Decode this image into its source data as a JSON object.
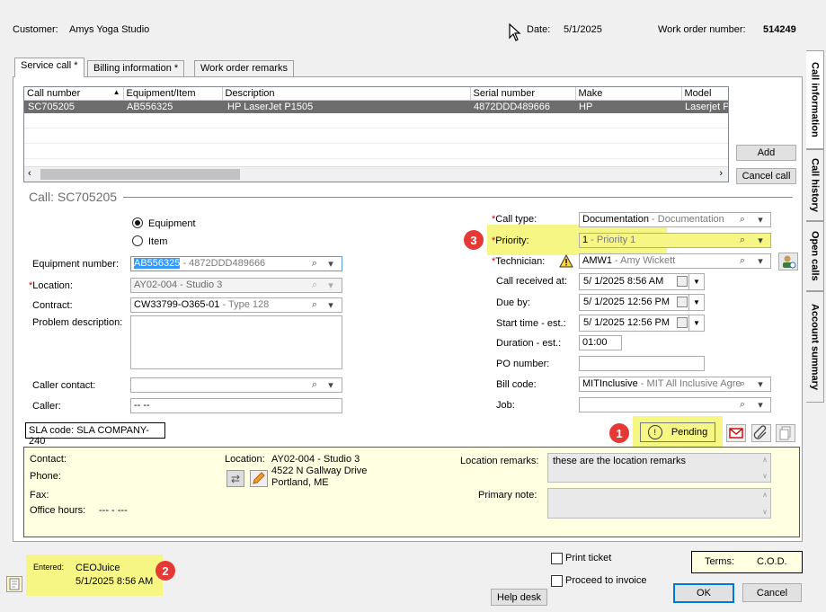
{
  "header": {
    "customer_label": "Customer:",
    "customer_value": "Amys Yoga Studio",
    "date_label": "Date:",
    "date_value": "5/1/2025",
    "wo_label": "Work order number:",
    "wo_value": "514249"
  },
  "tabs": [
    {
      "label": "Service call *"
    },
    {
      "label": "Billing information  *"
    },
    {
      "label": "Work order remarks"
    }
  ],
  "side_tabs": [
    {
      "label": "Call information"
    },
    {
      "label": "Call history"
    },
    {
      "label": "Open calls"
    },
    {
      "label": "Account summary"
    }
  ],
  "grid": {
    "columns": [
      "Call number",
      "Equipment/Item",
      "Description",
      "Serial number",
      "Make",
      "Model"
    ],
    "rows": [
      [
        "SC705205",
        "AB556325",
        "HP LaserJet P1505",
        "4872DDD489666",
        "HP",
        "Laserjet P"
      ]
    ]
  },
  "buttons": {
    "add": "Add",
    "cancel_call": "Cancel call",
    "pending": "Pending",
    "help_desk": "Help desk",
    "ok": "OK",
    "cancel": "Cancel"
  },
  "call_title": "Call: SC705205",
  "left_form": {
    "radio_equipment": "Equipment",
    "radio_item": "Item",
    "equipment_number_label": "Equipment number:",
    "equipment_number_value": "AB556325",
    "equipment_number_desc": " - 4872DDD489666",
    "location_label": "Location:",
    "location_value": "AY02-004",
    "location_desc": " - Studio 3",
    "contract_label": "Contract:",
    "contract_value": "CW33799-O365-01",
    "contract_desc": " - Type 128",
    "problem_label": "Problem description:",
    "caller_contact_label": "Caller contact:",
    "caller_label": "Caller:",
    "caller_value": "-- --"
  },
  "right_form": {
    "call_type_label": "Call type:",
    "call_type_value": "Documentation",
    "call_type_desc": " - Documentation",
    "priority_label": "Priority:",
    "priority_value": "1",
    "priority_desc": " - Priority 1",
    "technician_label": "Technician:",
    "technician_value": "AMW1",
    "technician_desc": " - Amy Wickett",
    "call_received_label": "Call received at:",
    "call_received_value": "5/  1/2025   8:56 AM",
    "due_by_label": "Due by:",
    "due_by_value": "5/  1/2025 12:56 PM",
    "start_time_label": "Start time - est.:",
    "start_time_value": "5/  1/2025 12:56 PM",
    "duration_label": "Duration - est.:",
    "duration_value": "01:00",
    "po_label": "PO number:",
    "bill_code_label": "Bill code:",
    "bill_code_value": "MITInclusive",
    "bill_code_desc": " - MIT All Inclusive Agre",
    "job_label": "Job:"
  },
  "sla_code": "SLA code: SLA COMPANY-240",
  "info_panel": {
    "contact_label": "Contact:",
    "phone_label": "Phone:",
    "fax_label": "Fax:",
    "office_hours_label": "Office hours:",
    "office_hours_value": "--- - ---",
    "location_label": "Location:",
    "location_line1": "AY02-004 - Studio 3",
    "location_line2": "4522 N Gallway Drive",
    "location_line3": "Portland, ME",
    "location_remarks_label": "Location remarks:",
    "location_remarks_value": "these are the location remarks",
    "primary_note_label": "Primary note:"
  },
  "footer": {
    "entered_label": "Entered:",
    "entered_by": "CEOJuice",
    "entered_at": "5/1/2025 8:56 AM",
    "print_ticket": "Print ticket",
    "proceed_invoice": "Proceed to invoice",
    "terms_label": "Terms:",
    "terms_value": "C.O.D."
  },
  "annotations": [
    "1",
    "2",
    "3"
  ]
}
